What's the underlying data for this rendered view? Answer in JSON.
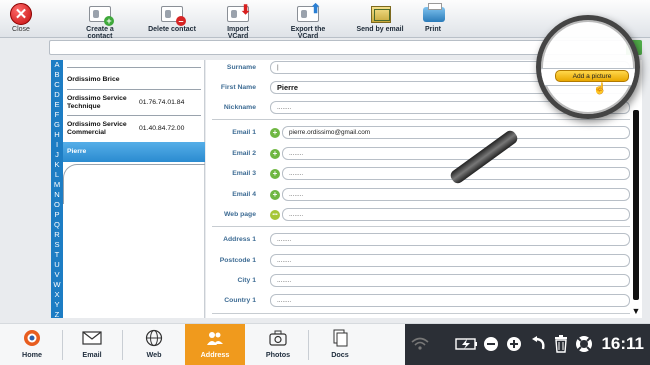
{
  "toolbar": {
    "close_label": "Close",
    "create_contact": "Create a contact",
    "delete_contact": "Delete contact",
    "import_vcard": "Import VCard",
    "export_vcard": "Export the VCard",
    "send_by_email": "Send by email",
    "print": "Print"
  },
  "search": {
    "value": ""
  },
  "alphabet": [
    "A",
    "B",
    "C",
    "D",
    "E",
    "F",
    "G",
    "H",
    "I",
    "J",
    "K",
    "L",
    "M",
    "N",
    "O",
    "P",
    "Q",
    "R",
    "S",
    "T",
    "U",
    "V",
    "W",
    "X",
    "Y",
    "Z"
  ],
  "contacts": [
    {
      "name": "Ordissimo Brice",
      "phone": ""
    },
    {
      "name": "Ordissimo Service Technique",
      "phone": "01.76.74.01.84"
    },
    {
      "name": "Ordissimo Service Commercial",
      "phone": "01.40.84.72.00"
    },
    {
      "name": "Pierre",
      "phone": "",
      "selected": true
    }
  ],
  "form": {
    "surname": {
      "label": "Surname",
      "value": "|"
    },
    "first_name": {
      "label": "First Name",
      "value": "Pierre"
    },
    "nickname": {
      "label": "Nickname",
      "placeholder": "........"
    },
    "email1": {
      "label": "Email 1",
      "value": "pierre.ordissimo@gmail.com"
    },
    "email2": {
      "label": "Email 2",
      "placeholder": "........"
    },
    "email3": {
      "label": "Email 3",
      "placeholder": "........"
    },
    "email4": {
      "label": "Email 4",
      "placeholder": "........"
    },
    "web_page": {
      "label": "Web page",
      "placeholder": "........"
    },
    "address1": {
      "label": "Address 1",
      "placeholder": "........"
    },
    "postcode1": {
      "label": "Postcode 1",
      "placeholder": "........"
    },
    "city1": {
      "label": "City 1",
      "placeholder": "........"
    },
    "country1": {
      "label": "Country 1",
      "placeholder": "........"
    }
  },
  "magnifier": {
    "add_picture": "Add a picture"
  },
  "dock": {
    "home": "Home",
    "email": "Email",
    "web": "Web",
    "address": "Address",
    "photos": "Photos",
    "docs": "Docs"
  },
  "status": {
    "time": "16:11"
  },
  "colors": {
    "accent": "#f09a1d",
    "alphabet_bar": "#1d7dc4",
    "selected_row": "#2b8bd0",
    "label_blue": "#3e6c94"
  }
}
